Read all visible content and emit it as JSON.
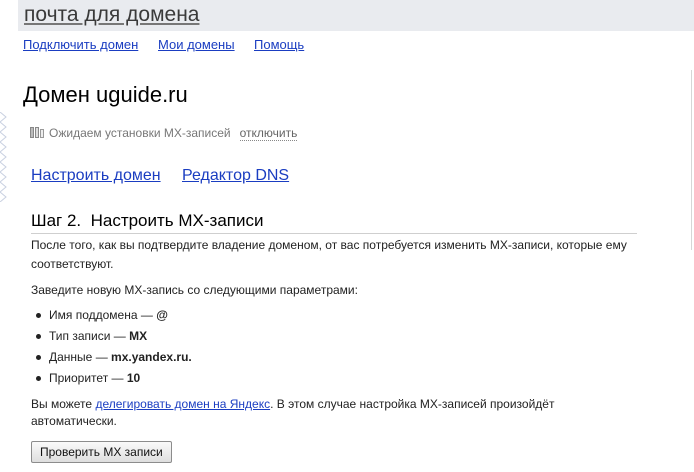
{
  "header": {
    "title": "почта для домена"
  },
  "topnav": {
    "items": [
      {
        "label": "Подключить домен"
      },
      {
        "label": "Мои домены"
      },
      {
        "label": "Помощь"
      }
    ]
  },
  "domain": {
    "title": "Домен uguide.ru",
    "status_text": "Ожидаем установки MX-записей",
    "disable_label": "отключить"
  },
  "tabs": [
    {
      "label": "Настроить домен"
    },
    {
      "label": "Редактор DNS"
    }
  ],
  "step": {
    "title": "Шаг 2.  Настроить MX-записи",
    "intro": "После того, как вы подтвердите владение доменом, от вас потребуется изменить MX-записи, которые ему соответствуют.",
    "instruction": "Заведите новую MX-запись со следующими параметрами:",
    "params": [
      {
        "label": "Имя поддомена — ",
        "value": "@"
      },
      {
        "label": "Тип записи — ",
        "value": "MX"
      },
      {
        "label": "Данные — ",
        "value": "mx.yandex.ru."
      },
      {
        "label": "Приоритет — ",
        "value": "10"
      }
    ],
    "note_before": "Вы можете ",
    "note_link": "делегировать домен на Яндекс",
    "note_after": ". В этом случае настройка MX-записей произойдёт автоматически.",
    "check_button": "Проверить MX записи"
  },
  "colors": {
    "link": "#1a3dc1",
    "header_bg": "#e9ebef"
  }
}
